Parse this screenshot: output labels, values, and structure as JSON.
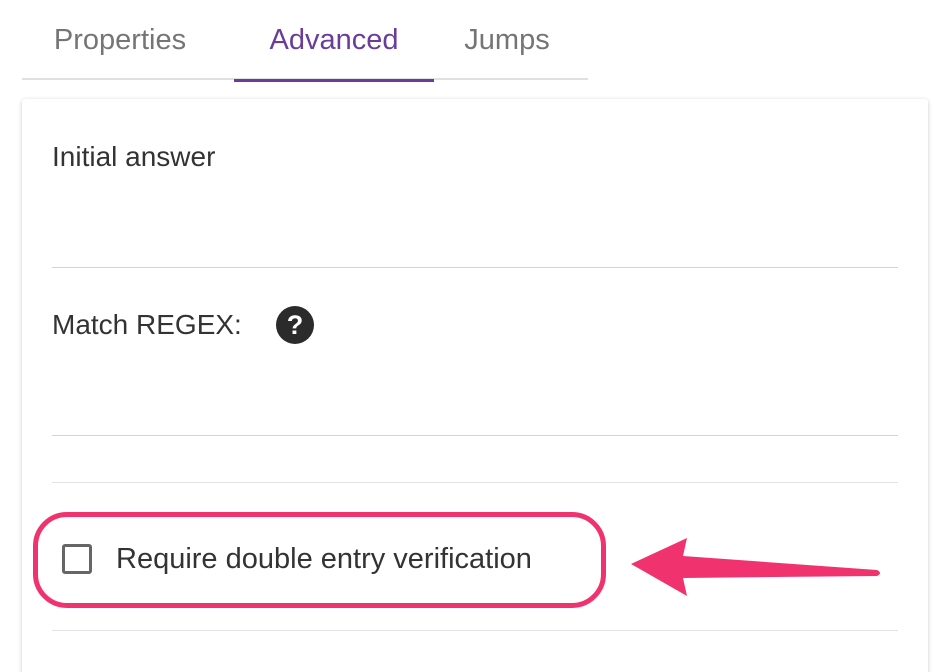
{
  "tabs": {
    "properties": "Properties",
    "advanced": "Advanced",
    "jumps": "Jumps",
    "active": "Advanced"
  },
  "form": {
    "initial_answer_label": "Initial answer",
    "initial_answer_value": "",
    "match_regex_label": "Match REGEX:",
    "match_regex_value": "",
    "help_icon": "question-circle-icon",
    "double_entry_label": "Require double entry verification",
    "double_entry_checked": false
  },
  "annotation": {
    "color": "#f0336f"
  },
  "colors": {
    "accent": "#6a3d9a"
  }
}
